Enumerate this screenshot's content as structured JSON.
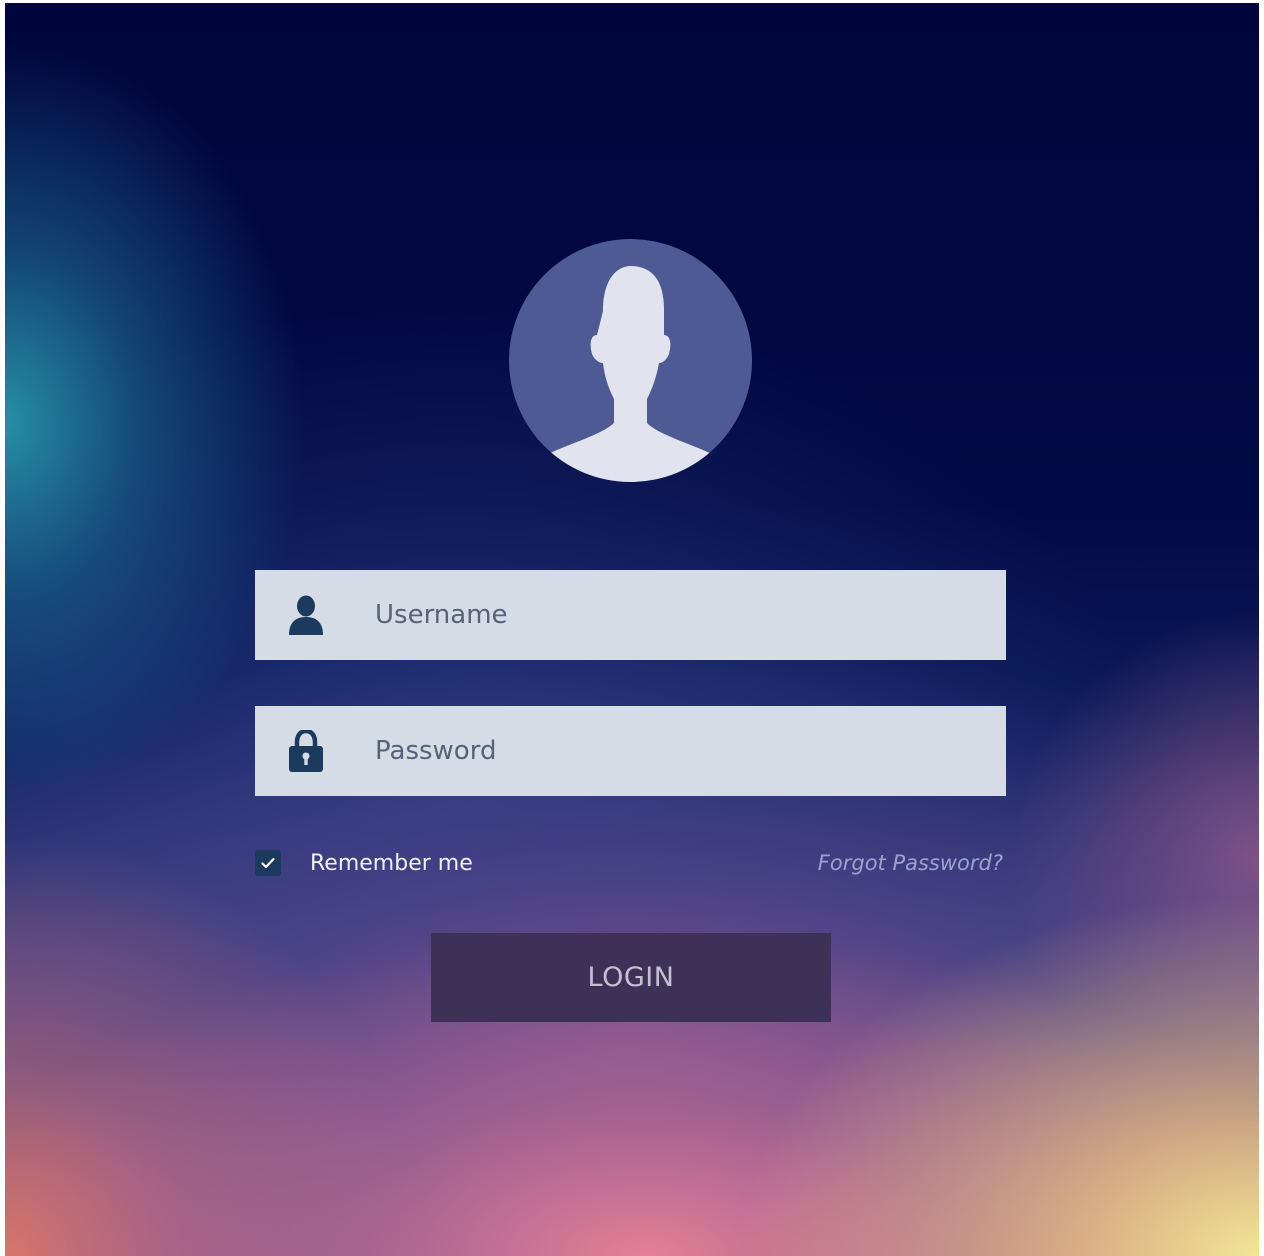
{
  "avatar": {
    "icon": "user-silhouette-icon"
  },
  "form": {
    "username": {
      "icon": "user-icon",
      "placeholder": "Username",
      "value": ""
    },
    "password": {
      "icon": "lock-icon",
      "placeholder": "Password",
      "value": ""
    },
    "remember": {
      "label": "Remember me",
      "checked": true,
      "icon": "checkmark-icon"
    },
    "forgot_label": "Forgot Password?",
    "login_label": "LOGIN"
  },
  "colors": {
    "background_top": "#01053d",
    "field_background": "#d6dce6",
    "field_icon": "#1c3a5e",
    "avatar_circle": "#4d5a93",
    "avatar_silhouette": "#e1e3ee",
    "login_button": "#3e3158",
    "forgot_link": "#9aa3d0"
  }
}
